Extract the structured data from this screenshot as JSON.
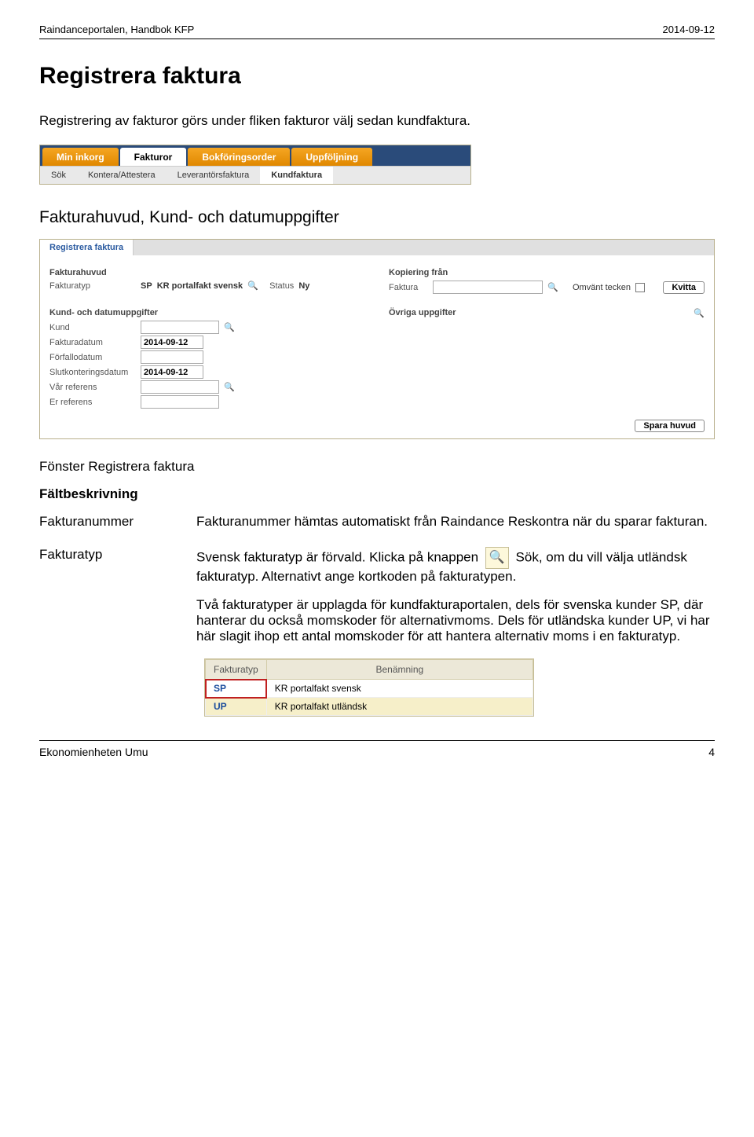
{
  "header": {
    "left": "Raindanceportalen, Handbok KFP",
    "right": "2014-09-12"
  },
  "title": "Registrera faktura",
  "intro": "Registrering av fakturor görs under fliken fakturor välj sedan kundfaktura.",
  "shot1": {
    "tabs": [
      "Min inkorg",
      "Fakturor",
      "Bokföringsorder",
      "Uppföljning"
    ],
    "active_tab": "Fakturor",
    "subtabs": [
      "Sök",
      "Kontera/Attestera",
      "Leverantörsfaktura",
      "Kundfaktura"
    ],
    "active_subtab": "Kundfaktura"
  },
  "section2_title": "Fakturahuvud, Kund- och datumuppgifter",
  "shot2": {
    "tab": "Registrera faktura",
    "left_header": "Fakturahuvud",
    "right_header": "Kopiering från",
    "fakturatyp_label": "Fakturatyp",
    "fakturatyp_val": "SP",
    "fakturatyp_desc": "KR portalfakt svensk",
    "status_label": "Status",
    "status_val": "Ny",
    "faktura_label": "Faktura",
    "omvent_label": "Omvänt tecken",
    "kvitta_btn": "Kvitta",
    "kund_header": "Kund- och datumuppgifter",
    "ovriga_header": "Övriga uppgifter",
    "rows": {
      "kund": "Kund",
      "fakturadatum": "Fakturadatum",
      "fakturadatum_val": "2014-09-12",
      "forfallodatum": "Förfallodatum",
      "slutkont": "Slutkonteringsdatum",
      "slutkont_val": "2014-09-12",
      "var_ref": "Vår referens",
      "er_ref": "Er referens"
    },
    "spara_btn": "Spara huvud"
  },
  "subsec_title": "Fönster Registrera faktura",
  "faltbeskrivning": "Fältbeskrivning",
  "desc": {
    "fakturanummer_label": "Fakturanummer",
    "fakturanummer_text": "Fakturanummer hämtas automatiskt från Raindance Reskontra när du sparar fakturan.",
    "fakturatyp_label": "Fakturatyp",
    "fakturatyp_text_a": "Svensk fakturatyp är förvald. Klicka på knappen ",
    "fakturatyp_text_b": " Sök, om du vill välja utländsk fakturatyp. Alternativt ange kortkoden på fakturatypen.",
    "fakturatyp_para2": "Två fakturatyper är upplagda för kundfakturaportalen, dels för svenska kunder SP, där hanterar du också momskoder för alternativmoms. Dels för utländska kunder UP, vi har här slagit ihop ett antal momskoder för att hantera alternativ moms i en fakturatyp."
  },
  "shot3": {
    "col1": "Fakturatyp",
    "col2": "Benämning",
    "rows": [
      {
        "code": "SP",
        "name": "KR portalfakt svensk",
        "hl": true
      },
      {
        "code": "UP",
        "name": "KR portalfakt utländsk",
        "hl": false
      }
    ]
  },
  "footer": {
    "left": "Ekonomienheten Umu",
    "page": "4"
  }
}
